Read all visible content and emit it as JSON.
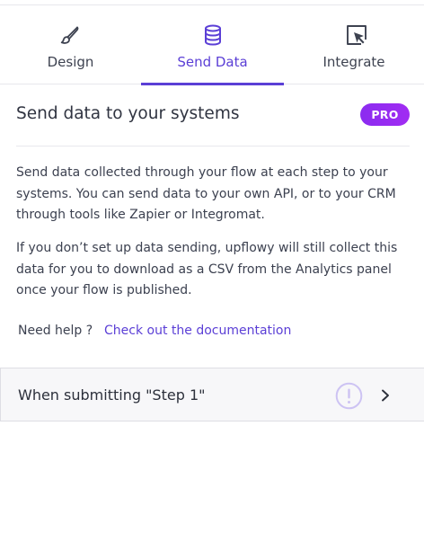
{
  "tabs": [
    {
      "label": "Design",
      "icon": "brush-icon",
      "active": false
    },
    {
      "label": "Send Data",
      "icon": "database-icon",
      "active": true
    },
    {
      "label": "Integrate",
      "icon": "embed-cursor-icon",
      "active": false
    }
  ],
  "header": {
    "title": "Send data to your systems",
    "badge": "PRO"
  },
  "content": {
    "paragraph1": "Send data collected through your flow at each step to your systems. You can send data to your own API, or to your CRM through tools like Zapier or Integromat.",
    "paragraph2": "If you don’t set up data sending, upflowy will still collect this data for you to download as a CSV from the Analytics panel once your flow is published.",
    "help_label": "Need help ?",
    "help_link": "Check out the documentation"
  },
  "step": {
    "label": "When submitting \"Step 1\"",
    "status_icon": "warning-icon",
    "action_icon": "chevron-right-icon"
  },
  "colors": {
    "accent": "#5b3fd6",
    "badge_start": "#8b2cf0",
    "badge_end": "#a12cf2",
    "warning_ring": "#cdc3f3"
  }
}
